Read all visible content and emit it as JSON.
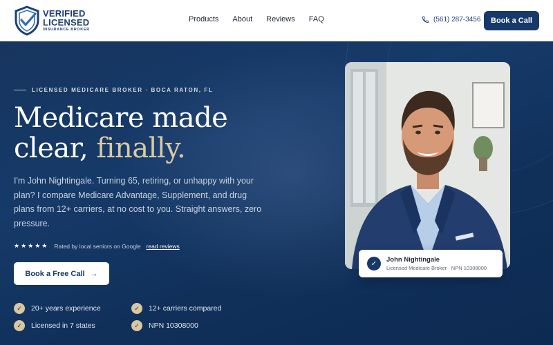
{
  "brand": {
    "line1": "VERIFIED",
    "line2": "LICENSED",
    "line3": "INSURANCE BROKER"
  },
  "nav": {
    "items": [
      {
        "label": "Products"
      },
      {
        "label": "About"
      },
      {
        "label": "Reviews"
      },
      {
        "label": "FAQ"
      }
    ],
    "phone": "(561) 287-3456",
    "cta": "Book a Call"
  },
  "hero": {
    "eyebrow": "LICENSED MEDICARE BROKER · BOCA RATON, FL",
    "headline_line1": "Medicare made",
    "headline_line2_plain": "clear, ",
    "headline_line2_accent": "finally.",
    "intro": "I'm John Nightingale. Turning 65, retiring, or unhappy with your plan? I compare Medicare Advantage, Supplement, and drug plans from 12+ carriers, at no cost to you. Straight answers, zero pressure.",
    "stars": "★★★★★",
    "rating_text": "Rated by local seniors on Google",
    "rating_link": "read reviews",
    "cta": "Book a Free Call",
    "cta_arrow": "→",
    "features": [
      {
        "label": "20+ years experience"
      },
      {
        "label": "12+ carriers compared"
      },
      {
        "label": "Licensed in 7 states"
      },
      {
        "label": "NPN 10308000"
      }
    ]
  },
  "profile": {
    "name": "John Nightingale",
    "subtitle": "Licensed Medicare Broker · NPN 10308000"
  },
  "colors": {
    "primary": "#17396a",
    "accent_gold": "#d9c9a3",
    "hero_bg": "#10305a"
  }
}
